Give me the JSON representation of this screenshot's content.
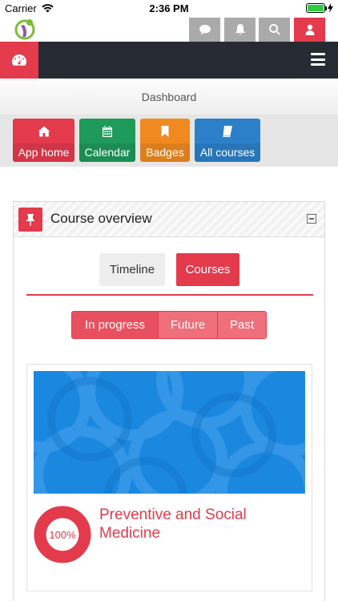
{
  "status_bar": {
    "carrier": "Carrier",
    "time": "2:36 PM",
    "battery_color": "#2ecc40"
  },
  "header": {
    "buttons": [
      "message-icon",
      "bell-icon",
      "search-icon",
      "user-icon"
    ],
    "user_button_color": "#e33a4c"
  },
  "nav": {
    "dashboard_icon": "dashboard-gauge-icon",
    "menu_icon": "hamburger-menu-icon"
  },
  "breadcrumb": {
    "label": "Dashboard"
  },
  "quick_links": [
    {
      "label": "App home",
      "icon": "home-icon",
      "color": "#e33a4c"
    },
    {
      "label": "Calendar",
      "icon": "calendar-icon",
      "color": "#1e9a5b"
    },
    {
      "label": "Badges",
      "icon": "bookmark-icon",
      "color": "#f0891f"
    },
    {
      "label": "All courses",
      "icon": "book-icon",
      "color": "#2b80c9"
    }
  ],
  "course_overview": {
    "title": "Course overview",
    "tabs": [
      {
        "label": "Timeline",
        "active": false
      },
      {
        "label": "Courses",
        "active": true
      }
    ],
    "filters": [
      {
        "label": "In progress",
        "active": true
      },
      {
        "label": "Future",
        "active": false
      },
      {
        "label": "Past",
        "active": false
      }
    ],
    "course": {
      "name": "Preventive and Social Medicine",
      "progress_label": "100%",
      "progress": 1.0
    }
  },
  "colors": {
    "accent": "#e33a4c",
    "navbar": "#262b33",
    "course_image": "#1b88e0"
  }
}
